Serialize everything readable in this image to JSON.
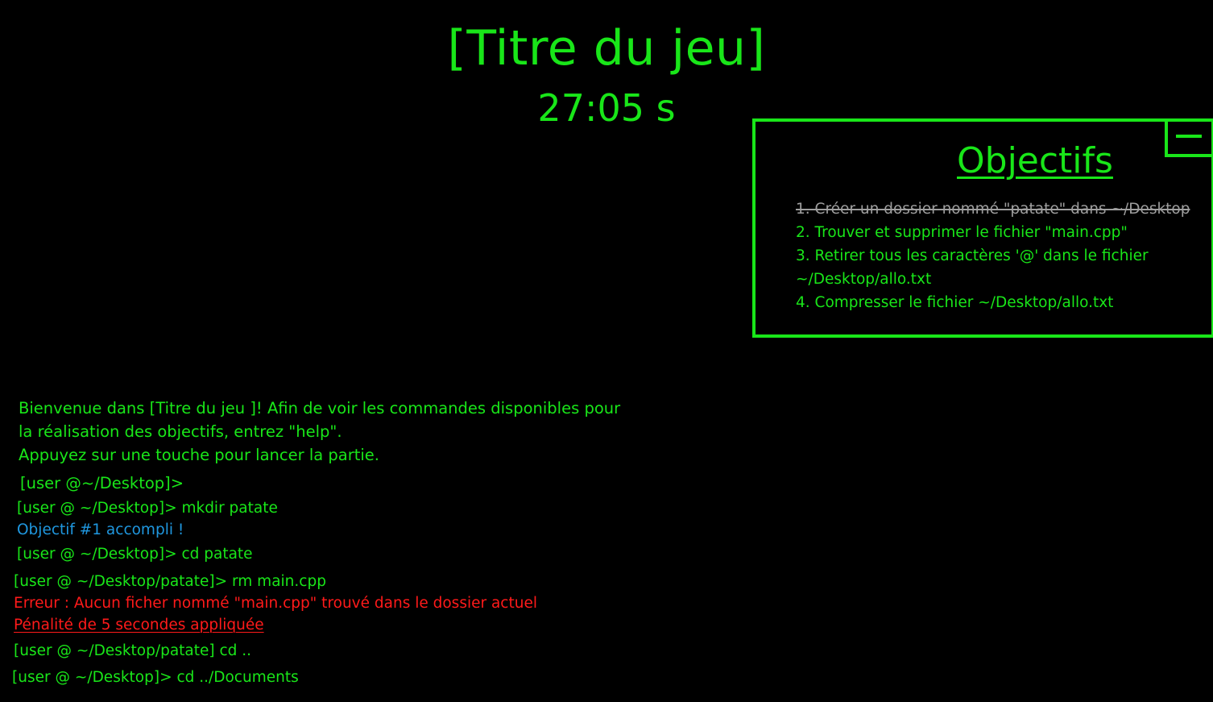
{
  "game": {
    "title": "[Titre du jeu]",
    "timer": "27:05 s"
  },
  "objectives": {
    "heading": "Objectifs",
    "minimize_icon": "minus-icon",
    "items": [
      {
        "text": "1. Créer un dossier nommé \"patate\" dans ~/Desktop",
        "done": true
      },
      {
        "text": "2. Trouver et supprimer le fichier \"main.cpp\"",
        "done": false
      },
      {
        "text": "3. Retirer tous les caractères '@' dans le fichier",
        "done": false
      },
      {
        "text": "~/Desktop/allo.txt",
        "done": false
      },
      {
        "text": "4. Compresser le fichier ~/Desktop/allo.txt",
        "done": false
      }
    ]
  },
  "console": {
    "welcome": [
      "Bienvenue dans [Titre du jeu ]! Afin de voir les commandes disponibles pour",
      "la réalisation des objectifs, entrez \"help\".",
      "Appuyez sur une touche pour lancer la partie."
    ],
    "prompt_initial": "[user @~/Desktop]>",
    "cmd_mkdir": "[user @ ~/Desktop]> mkdir patate",
    "objective_done": "Objectif #1 accompli !",
    "cmd_cd_patate": "[user @ ~/Desktop]> cd patate",
    "cmd_rm": "[user @ ~/Desktop/patate]> rm main.cpp",
    "error_msg": "Erreur : Aucun ficher nommé \"main.cpp\" trouvé dans le dossier actuel",
    "penalty_msg": "Pénalité de 5 secondes appliquée",
    "cmd_cd_up": "[user @ ~/Desktop/patate] cd ..",
    "cmd_current": "[user @ ~/Desktop]>  cd ../Documents"
  },
  "colors": {
    "text": "#19e619",
    "done": "#9e9e9e",
    "info": "#1f97df",
    "error": "#ff1a1a",
    "background": "#000000"
  }
}
